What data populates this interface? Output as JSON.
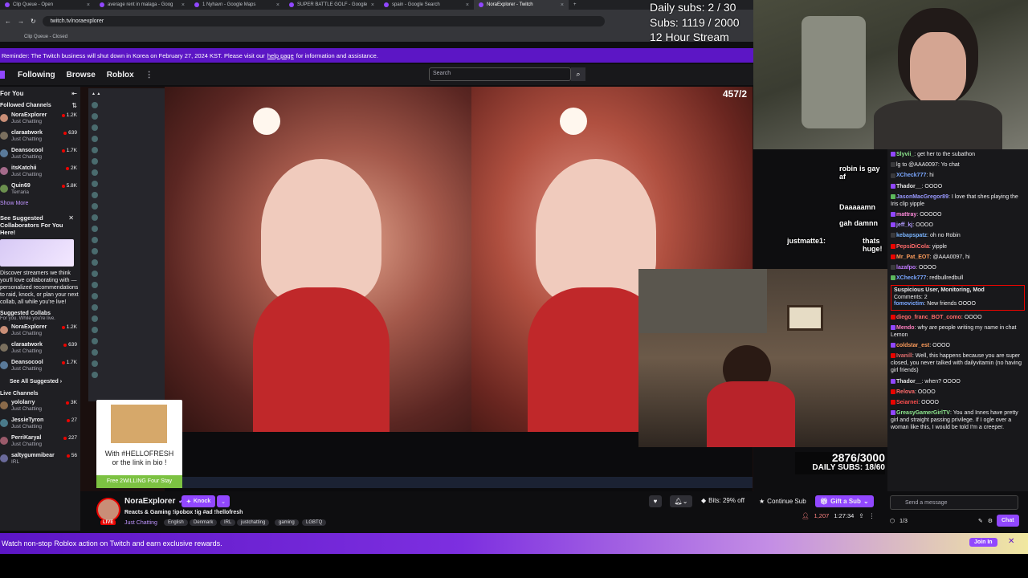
{
  "browser": {
    "tabs": [
      {
        "title": "Clip Queue - Open",
        "active": false
      },
      {
        "title": "average rent in malaga - Goog",
        "active": false
      },
      {
        "title": "1 Nyhavn - Google Maps",
        "active": false
      },
      {
        "title": "SUPER BATTLE GOLF - Google",
        "active": false
      },
      {
        "title": "spain - Google Search",
        "active": false
      },
      {
        "title": "NoraExplorer - Twitch",
        "active": true
      }
    ],
    "url": "twitch.tv/noraexplorer",
    "bookmark": "Clip Queue - Closed"
  },
  "notice": {
    "text_before": "Reminder: The Twitch business will shut down in Korea on February 27, 2024 KST. Please visit our",
    "link": "help page",
    "text_after": "for information and assistance."
  },
  "topnav": {
    "following": "Following",
    "browse": "Browse",
    "roblox": "Roblox",
    "search_placeholder": "Search"
  },
  "sidebar": {
    "for_you": "For You",
    "followed_title": "Followed Channels",
    "followed": [
      {
        "name": "NoraExplorer",
        "game": "Just Chatting",
        "viewers": "1.2K",
        "color": "#c98e77"
      },
      {
        "name": "claraatwork",
        "game": "Just Chatting",
        "viewers": "639",
        "color": "#7a6f5e"
      },
      {
        "name": "Deansocool",
        "game": "Just Chatting",
        "viewers": "1.7K",
        "color": "#5a7a9a"
      },
      {
        "name": "itsKatchii",
        "game": "Just Chatting",
        "viewers": "2K",
        "color": "#a46a8a"
      },
      {
        "name": "Quin69",
        "game": "Terraria",
        "viewers": "5.8K",
        "color": "#6b8f4e"
      }
    ],
    "show_more": "Show More",
    "suggest": {
      "title": "See Suggested Collaborators For You Here!",
      "body": "Discover streamers we think you'll love collaborating with — personalized recommendations to raid, knock, or plan your next collab, all while you're live!"
    },
    "collabs_title": "Suggested Collabs",
    "collabs_sub": "For you. While you're live.",
    "collabs": [
      {
        "name": "NoraExplorer",
        "game": "Just Chatting",
        "viewers": "1.2K",
        "color": "#c98e77"
      },
      {
        "name": "claraatwork",
        "game": "Just Chatting",
        "viewers": "639",
        "color": "#7a6f5e"
      },
      {
        "name": "Deansocool",
        "game": "Just Chatting",
        "viewers": "1.7K",
        "color": "#5a7a9a"
      }
    ],
    "see_all": "See All Suggested",
    "live_title": "Live Channels",
    "live": [
      {
        "name": "yololarry",
        "game": "Just Chatting",
        "viewers": "3K",
        "color": "#8a6a4a"
      },
      {
        "name": "JessieTyron",
        "game": "Just Chatting",
        "viewers": "27",
        "color": "#4a7a8a"
      },
      {
        "name": "PerriKaryal",
        "game": "Just Chatting",
        "viewers": "227",
        "color": "#9a5a6a"
      },
      {
        "name": "saltygummibear",
        "game": "IRL",
        "viewers": "56",
        "color": "#6a6a9a"
      }
    ]
  },
  "video": {
    "counter": "457/2",
    "overlay_sub_count": "2876/3000",
    "overlay_daily": "DAILY SUBS: 18/60"
  },
  "hellofresh": {
    "line1": "With #HELLOFRESH",
    "line2": "or the link in bio !",
    "footer": "Free 2WILLING Four Stay"
  },
  "stream_overlay": {
    "line1": "Daily subs: 2 / 30",
    "line2": "Subs: 1119 / 2000",
    "line3": "12 Hour Stream"
  },
  "chat_overlay": [
    {
      "text": "robin is gay af"
    },
    {
      "text": "Daaaaamn"
    },
    {
      "text": "gah damnn"
    },
    {
      "text": "justmatte1:"
    },
    {
      "text": "thats huge!"
    }
  ],
  "channel": {
    "name": "NoraExplorer",
    "knock": "Knock",
    "title": "Reacts & Gaming !ipobox !ig #ad !hellofresh",
    "category": "Just Chatting",
    "tags": [
      "English",
      "Denmark",
      "IRL",
      "justchatting",
      "gaming",
      "LGBTQ"
    ],
    "live": "LIVE",
    "bits": "Bits: 29% off",
    "continue_sub": "Continue Sub",
    "gift_sub": "Gift a Sub",
    "viewers": "1,207",
    "uptime": "1:27:34"
  },
  "chat": {
    "messages": [
      {
        "user": "Slyvii_",
        "text": "get her to the subathon",
        "color": "#8ee88e",
        "badge": "#9147ff"
      },
      {
        "user": "",
        "text": "lg to @AAA0097: Yo chat",
        "color": "#bf94ff",
        "badge": "#3a3a3d"
      },
      {
        "user": "XCheck777",
        "text": "hi",
        "color": "#7aa7ff",
        "badge": "#3a3a3d"
      },
      {
        "user": "Thador__",
        "text": "OOOO",
        "color": "#e5e5e5",
        "badge": "#9147ff"
      },
      {
        "user": "JasonMacGregor89",
        "text": "I love that shes playing the Iris clip yipple",
        "color": "#9999ff",
        "badge": "#5cb85c"
      },
      {
        "user": "mattray",
        "text": "OOOOO",
        "color": "#ff8adb",
        "badge": "#9147ff"
      },
      {
        "user": "jeff_kj",
        "text": "OOOO",
        "color": "#b19aff",
        "badge": "#9147ff"
      },
      {
        "user": "kebapspatz",
        "text": "oh no Robin",
        "color": "#7ab5ff",
        "badge": "#3a3a3d"
      },
      {
        "user": "PepsiDiCola",
        "text": "yipple",
        "color": "#ff6b6b",
        "badge": "#eb0400"
      },
      {
        "user": "Mr_Pat_EOT",
        "text": "@AAA0097, hi",
        "color": "#ff9d5c",
        "badge": "#eb0400"
      },
      {
        "user": "lazafpo",
        "text": "OOOO",
        "color": "#c07aff",
        "badge": "#3a3a3d"
      },
      {
        "user": "XCheck777",
        "text": "redbullredbull",
        "color": "#7aa7ff",
        "badge": "#5cb85c"
      }
    ],
    "suspicious": {
      "title": "Suspicious User, Monitoring, Mod",
      "comments": "Comments: 2",
      "user": "fomovictim",
      "text": "New friends OOOO"
    },
    "messages2": [
      {
        "user": "diego_franc_BOT_como",
        "text": "OOOO",
        "color": "#ff6b6b",
        "badge": "#eb0400"
      },
      {
        "user": "Mendo",
        "text": "why are people writing my name in chat Lemon",
        "color": "#ff7fbf",
        "badge": "#9147ff"
      },
      {
        "user": "coldstar_est",
        "text": "OOOO",
        "color": "#ff9d5c",
        "badge": "#9147ff"
      },
      {
        "user": "Ivanill",
        "text": "Well, this happens because you are super closed, you never talked with dailyvitamin (no having girl friends)",
        "color": "#e06c6c",
        "badge": "#eb0400"
      },
      {
        "user": "Thador__",
        "text": "when? OOOO",
        "color": "#e5e5e5",
        "badge": "#9147ff"
      },
      {
        "user": "Relova",
        "text": "OOOO",
        "color": "#ff6b6b",
        "badge": "#eb0400"
      },
      {
        "user": "Seiarnei",
        "text": "OOOO",
        "color": "#ff4f4f",
        "badge": "#eb0400"
      },
      {
        "user": "GreasyGamerGirlTV",
        "text": "You and Innes have pretty girl and straight passing privilege. If I ogle over a woman like this, I would be told I'm a creeper.",
        "color": "#8ee88e",
        "badge": "#9147ff"
      }
    ],
    "input_placeholder": "Send a message",
    "points": "1/3",
    "chat_button": "Chat"
  },
  "promo": {
    "text": "Watch non-stop Roblox action on Twitch and earn exclusive rewards.",
    "join": "Join In"
  }
}
